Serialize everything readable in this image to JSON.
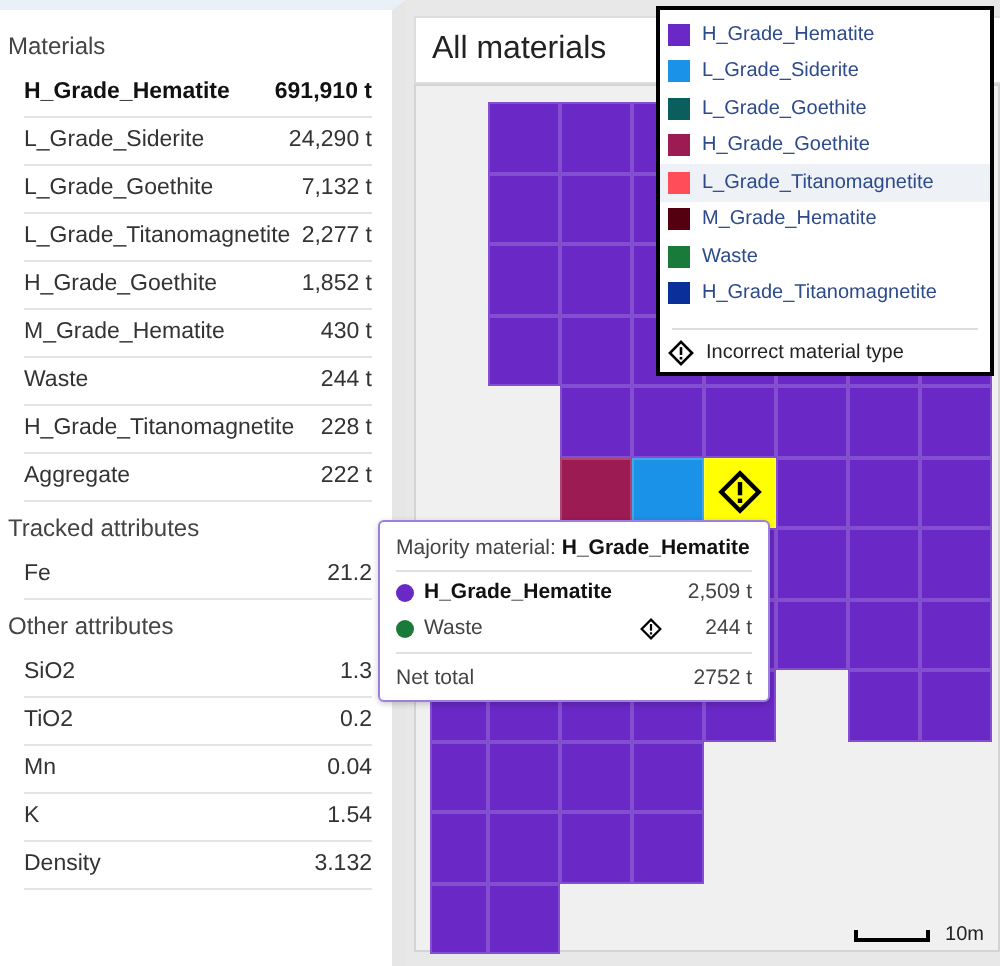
{
  "sidebar": {
    "sections": [
      {
        "title": "Materials",
        "rows": [
          {
            "name": "H_Grade_Hematite",
            "value": "691,910 t",
            "emphasized": true
          },
          {
            "name": "L_Grade_Siderite",
            "value": "24,290 t",
            "emphasized": false
          },
          {
            "name": "L_Grade_Goethite",
            "value": "7,132 t",
            "emphasized": false
          },
          {
            "name": "L_Grade_Titanomagnetite",
            "value": "2,277 t",
            "emphasized": false
          },
          {
            "name": "H_Grade_Goethite",
            "value": "1,852 t",
            "emphasized": false
          },
          {
            "name": "M_Grade_Hematite",
            "value": "430 t",
            "emphasized": false
          },
          {
            "name": "Waste",
            "value": "244 t",
            "emphasized": false
          },
          {
            "name": "H_Grade_Titanomagnetite",
            "value": "228 t",
            "emphasized": false
          },
          {
            "name": "Aggregate",
            "value": "222 t",
            "emphasized": false
          }
        ]
      },
      {
        "title": "Tracked attributes",
        "rows": [
          {
            "name": "Fe",
            "value": "21.2",
            "emphasized": false
          }
        ]
      },
      {
        "title": "Other attributes",
        "rows": [
          {
            "name": "SiO2",
            "value": "1.3",
            "emphasized": false
          },
          {
            "name": "TiO2",
            "value": "0.2",
            "emphasized": false
          },
          {
            "name": "Mn",
            "value": "0.04",
            "emphasized": false
          },
          {
            "name": "K",
            "value": "1.54",
            "emphasized": false
          },
          {
            "name": "Density",
            "value": "3.132",
            "emphasized": false
          }
        ]
      }
    ]
  },
  "map": {
    "title": "All materials",
    "legend": {
      "items": [
        {
          "label": "H_Grade_Hematite",
          "color": "#6a28c6",
          "hovered": false
        },
        {
          "label": "L_Grade_Siderite",
          "color": "#1a92e8",
          "hovered": false
        },
        {
          "label": "L_Grade_Goethite",
          "color": "#0b5e5e",
          "hovered": false
        },
        {
          "label": "H_Grade_Goethite",
          "color": "#9b1b52",
          "hovered": false
        },
        {
          "label": "L_Grade_Titanomagnetite",
          "color": "#ff4d5a",
          "hovered": true
        },
        {
          "label": "M_Grade_Hematite",
          "color": "#550010",
          "hovered": false
        },
        {
          "label": "Waste",
          "color": "#1a7a3a",
          "hovered": false
        },
        {
          "label": "H_Grade_Titanomagnetite",
          "color": "#0a2f9a",
          "hovered": false
        }
      ],
      "warning_label": "Incorrect material type"
    },
    "tooltip": {
      "heading": "Majority material: **H_Grade_Hematite**",
      "rows": [
        {
          "name": "H_Grade_Hematite",
          "value": "2,509 t",
          "color": "#6a28c6",
          "majority": true,
          "flagged": false
        },
        {
          "name": "Waste",
          "value": "244 t",
          "color": "#1a7a3a",
          "majority": false,
          "flagged": true
        }
      ],
      "total_label": "Net total",
      "total_value": "2752 t"
    },
    "scale_label": "10m"
  }
}
